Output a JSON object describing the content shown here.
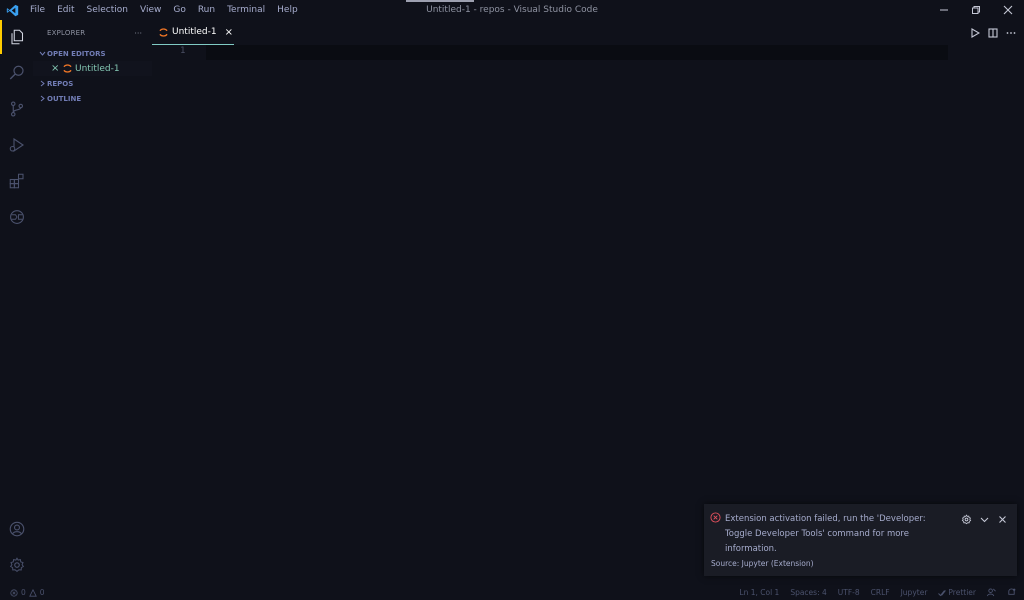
{
  "window": {
    "title": "Untitled-1 - repos - Visual Studio Code",
    "menu": [
      "File",
      "Edit",
      "Selection",
      "View",
      "Go",
      "Run",
      "Terminal",
      "Help"
    ]
  },
  "activity_bar": {
    "icons": [
      "explorer-icon",
      "search-icon",
      "source-control-icon",
      "run-debug-icon",
      "extensions-icon",
      "remote-explorer-icon",
      "account-icon",
      "settings-gear-icon"
    ],
    "active": "explorer-icon",
    "accent_color": "#ffcc00"
  },
  "sidebar": {
    "title": "EXPLORER",
    "more": "···",
    "sections": {
      "open_editors": "OPEN EDITORS",
      "repos": "REPOS",
      "outline": "OUTLINE"
    },
    "open_editors": [
      {
        "close": "×",
        "name": "Untitled-1"
      }
    ]
  },
  "tabs": [
    {
      "label": "Untitled-1",
      "close": "×"
    }
  ],
  "editor": {
    "line_numbers": [
      "1"
    ]
  },
  "notification": {
    "message": "Extension activation failed, run the 'Developer: Toggle Developer Tools' command for more information.",
    "source": "Source: Jupyter (Extension)",
    "error_color": "#e2505d"
  },
  "statusbar": {
    "errors": "0",
    "warnings": "0",
    "position": "Ln 1, Col 1",
    "spaces": "Spaces: 4",
    "encoding": "UTF-8",
    "eol": "CRLF",
    "language": "Jupyter",
    "prettier": "Prettier"
  },
  "colors": {
    "background": "#0f111a",
    "tab_underline": "#80cbc4",
    "notification_bg": "#1a1c25"
  }
}
